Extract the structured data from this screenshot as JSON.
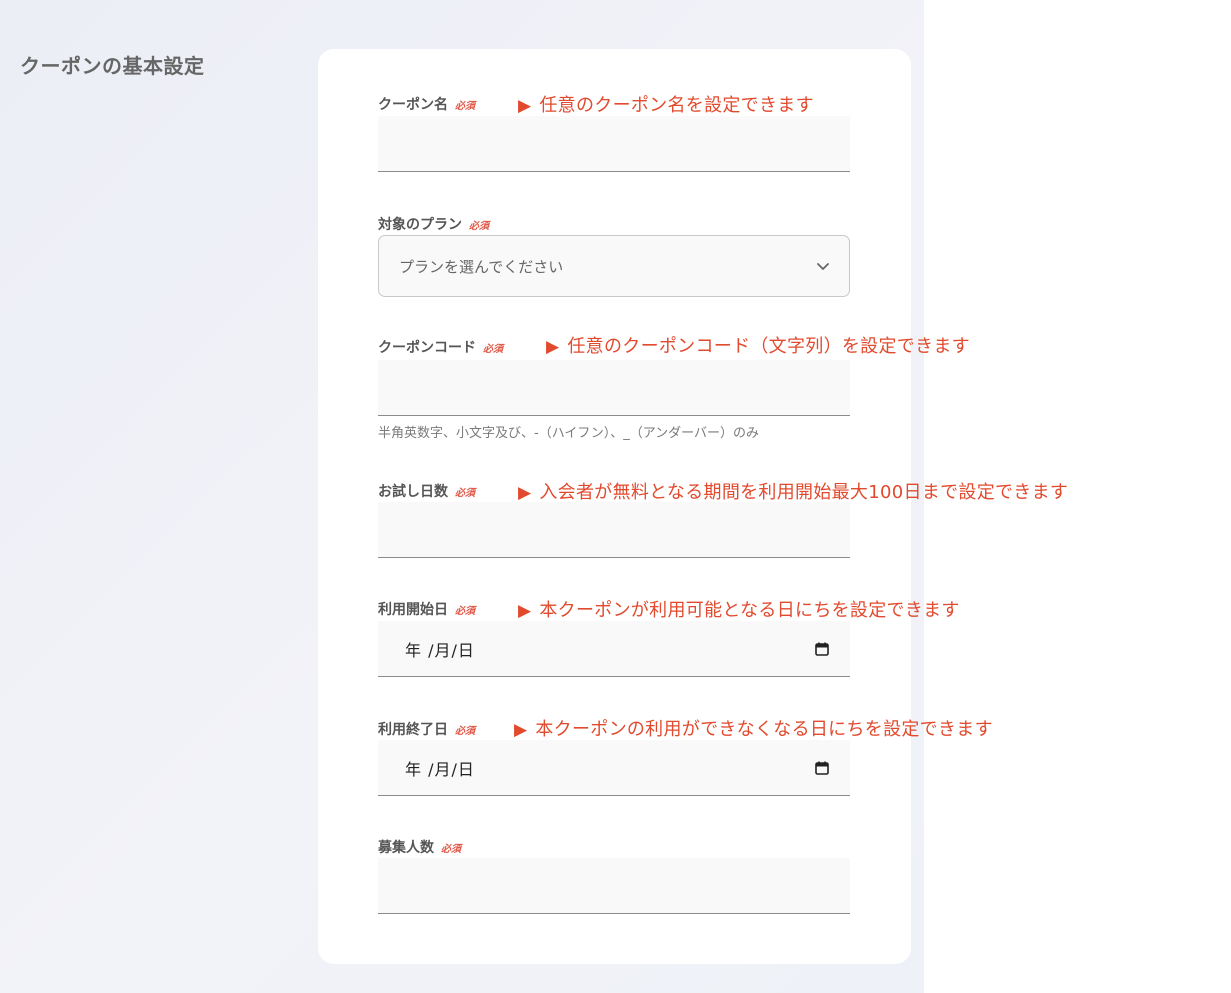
{
  "section": {
    "title": "クーポンの基本設定"
  },
  "required_badge": "必須",
  "fields": {
    "coupon_name": {
      "label": "クーポン名",
      "note": "任意のクーポン名を設定できます",
      "value": ""
    },
    "plan": {
      "label": "対象のプラン",
      "placeholder": "プランを選んでください"
    },
    "coupon_code": {
      "label": "クーポンコード",
      "note": "任意のクーポンコード（文字列）を設定できます",
      "helper": "半角英数字、小文字及び、-（ハイフン）、_（アンダーバー）のみ",
      "value": ""
    },
    "trial_days": {
      "label": "お試し日数",
      "note": "入会者が無料となる期間を利用開始最大100日まで設定できます",
      "value": ""
    },
    "start_date": {
      "label": "利用開始日",
      "note": "本クーポンが利用可能となる日にちを設定できます",
      "placeholder": "年 /月/日"
    },
    "end_date": {
      "label": "利用終了日",
      "note": "本クーポンの利用ができなくなる日にちを設定できます",
      "placeholder": "年 /月/日"
    },
    "capacity": {
      "label": "募集人数",
      "value": ""
    }
  },
  "note_marker": "▶",
  "colors": {
    "accent": "#e24a2e",
    "required": "#e05a4a",
    "panel_bg": "#eceef6",
    "card_bg": "#ffffff"
  },
  "icons": {
    "select_arrow": "chevron-down-icon",
    "date_picker": "calendar-icon"
  }
}
